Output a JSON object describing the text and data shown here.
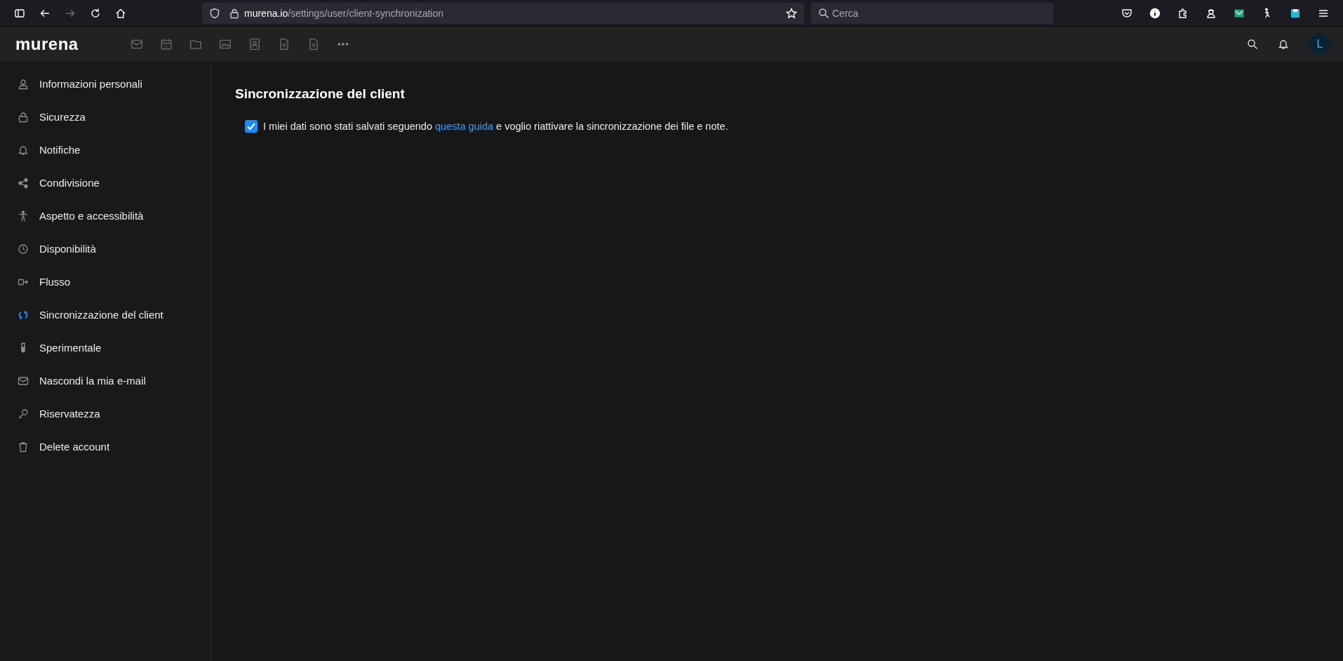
{
  "browser": {
    "url_host": "murena.io",
    "url_path": "/settings/user/client-synchronization",
    "search": {
      "placeholder": "Cerca"
    },
    "forward_disabled": true
  },
  "app_header": {
    "logo": "murena",
    "avatar": "L"
  },
  "sidebar": {
    "items": [
      {
        "label": "Informazioni personali",
        "selected": false
      },
      {
        "label": "Sicurezza",
        "selected": false
      },
      {
        "label": "Notifiche",
        "selected": false
      },
      {
        "label": "Condivisione",
        "selected": false
      },
      {
        "label": "Aspetto e accessibilità",
        "selected": false
      },
      {
        "label": "Disponibilità",
        "selected": false
      },
      {
        "label": "Flusso",
        "selected": false
      },
      {
        "label": "Sincronizzazione del client",
        "selected": true
      },
      {
        "label": "Sperimentale",
        "selected": false
      },
      {
        "label": "Nascondi la mia e-mail",
        "selected": false
      },
      {
        "label": "Riservatezza",
        "selected": false
      },
      {
        "label": "Delete account",
        "selected": false
      }
    ]
  },
  "content": {
    "title": "Sincronizzazione del client",
    "consent": {
      "checked": true,
      "before": "I miei dati sono stati salvati seguendo",
      "link": "questa guida",
      "after": "e voglio riattivare la sincronizzazione dei file e note."
    }
  }
}
